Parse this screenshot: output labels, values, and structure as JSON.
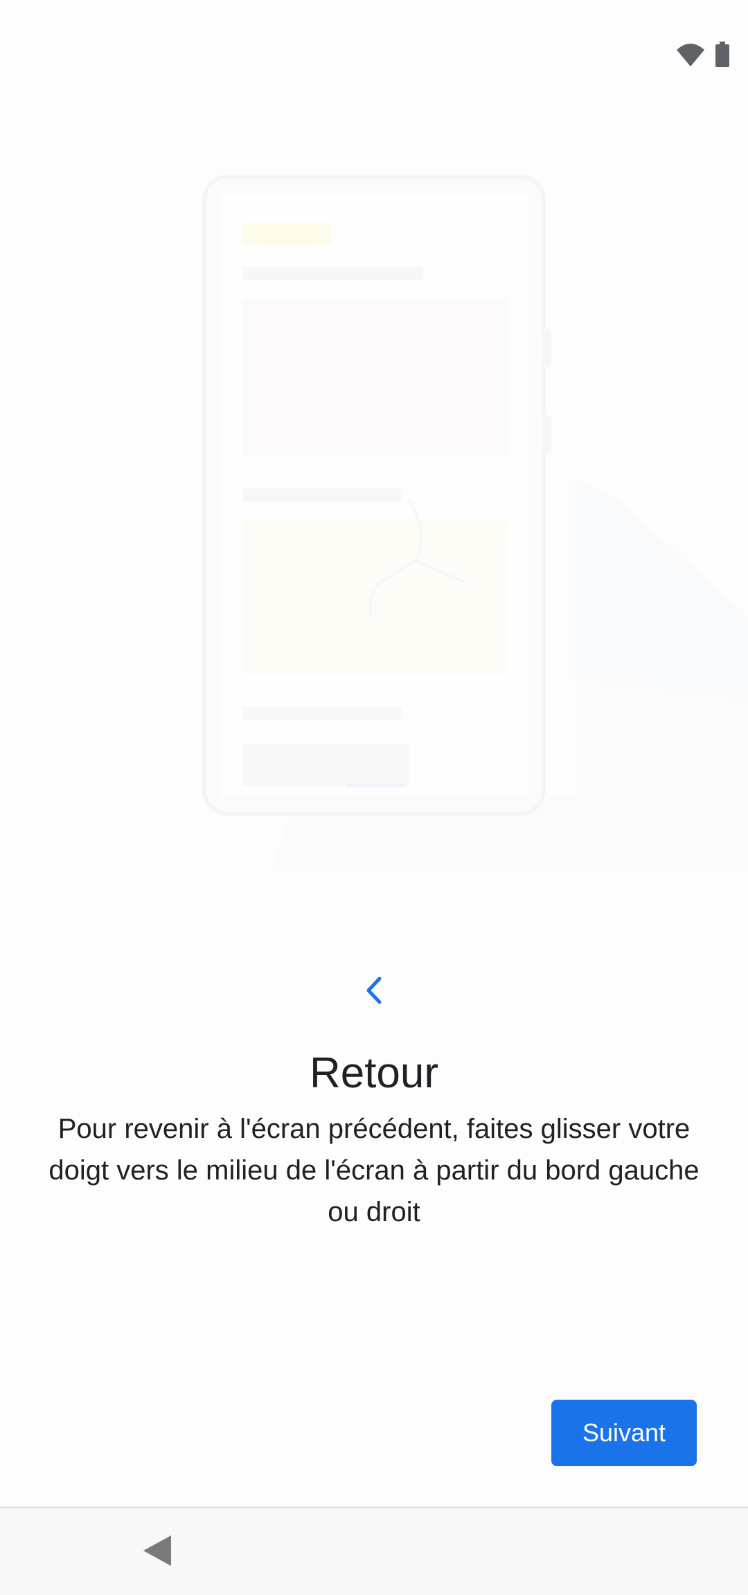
{
  "status_bar": {
    "icons": [
      "wifi-icon",
      "battery-icon"
    ]
  },
  "illustration": {
    "icon": "phone-swipe-illustration"
  },
  "gesture_indicator": {
    "icon": "chevron-left-icon",
    "color": "#1a73e8"
  },
  "content": {
    "title": "Retour",
    "description": "Pour revenir à l'écran précédent, faites glisser votre doigt vers le milieu de l'écran à partir du bord gauche ou droit"
  },
  "actions": {
    "next_label": "Suivant",
    "accent_color": "#1a73e8"
  },
  "navigation_bar": {
    "back_icon": "nav-back-triangle-icon"
  }
}
